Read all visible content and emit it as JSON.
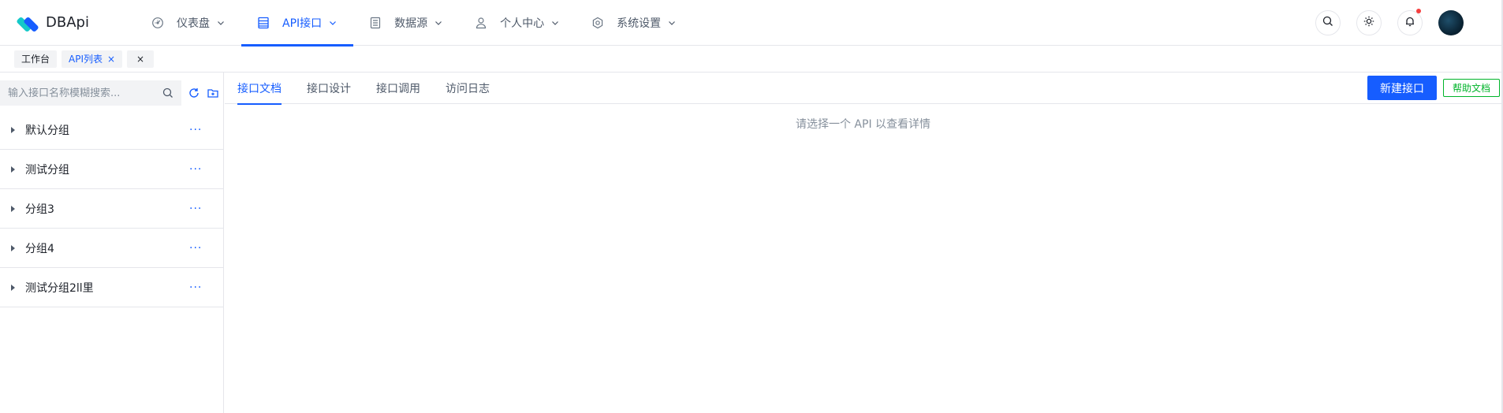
{
  "app": {
    "logo_text": "DBApi"
  },
  "nav": {
    "items": [
      {
        "label": "仪表盘",
        "icon": "dashboard-icon"
      },
      {
        "label": "API接口",
        "icon": "table-icon",
        "active": true
      },
      {
        "label": "数据源",
        "icon": "datasource-icon"
      },
      {
        "label": "个人中心",
        "icon": "user-icon"
      },
      {
        "label": "系统设置",
        "icon": "gear-icon"
      }
    ]
  },
  "header_actions": {
    "icons": [
      "search-icon",
      "theme-sun-icon",
      "bell-icon"
    ],
    "notification_dot_color": "#f53f3f"
  },
  "tags": {
    "items": [
      {
        "label": "工作台",
        "active": false
      },
      {
        "label": "API列表",
        "active": true,
        "close": "×"
      }
    ],
    "close_all": "×"
  },
  "sidebar": {
    "search_placeholder": "输入接口名称模糊搜索...",
    "groups": [
      {
        "label": "默认分组",
        "more": "···"
      },
      {
        "label": "测试分组",
        "more": "···"
      },
      {
        "label": "分组3",
        "more": "···"
      },
      {
        "label": "分组4",
        "more": "···"
      },
      {
        "label": "测试分组2ll里",
        "more": "···"
      }
    ]
  },
  "main": {
    "tabs": [
      {
        "label": "接口文档",
        "active": true
      },
      {
        "label": "接口设计"
      },
      {
        "label": "接口调用"
      },
      {
        "label": "访问日志"
      }
    ],
    "new_button": "新建接口",
    "help_button": "帮助文档",
    "empty_text": "请选择一个 API 以查看详情"
  },
  "colors": {
    "primary": "#165dff",
    "success": "#00b42a",
    "border": "#e5e6eb"
  }
}
